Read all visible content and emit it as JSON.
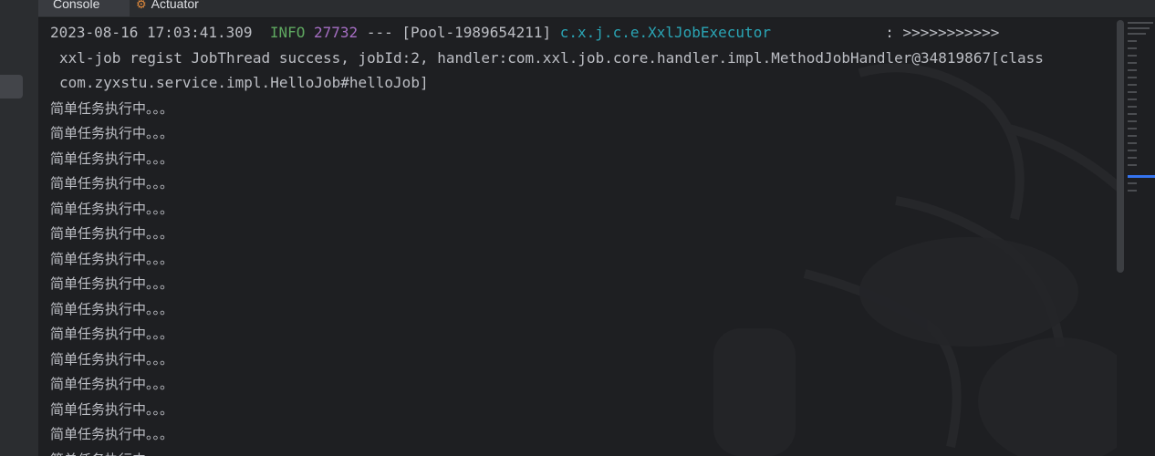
{
  "tabs": {
    "console_label": "Console",
    "actuator_label": "Actuator"
  },
  "log": {
    "header": {
      "timestamp": "2023-08-16 17:03:41.309",
      "level": "INFO",
      "pid": "27732",
      "separator": "---",
      "thread": "[Pool-1989654211]",
      "logger": "c.x.j.c.e.XxlJobExecutor",
      "arrow": ": >>>>>>>>>>>"
    },
    "continuation_1": "xxl-job regist JobThread success, jobId:2, handler:com.xxl.job.core.handler.impl.MethodJobHandler@34819867[class",
    "continuation_2": "com.zyxstu.service.impl.HelloJob#helloJob]",
    "task_lines": [
      "简单任务执行中。。。",
      "简单任务执行中。。。",
      "简单任务执行中。。。",
      "简单任务执行中。。。",
      "简单任务执行中。。。",
      "简单任务执行中。。。",
      "简单任务执行中。。。",
      "简单任务执行中。。。",
      "简单任务执行中。。。",
      "简单任务执行中。。。",
      "简单任务执行中。。。",
      "简单任务执行中。。。",
      "简单任务执行中。。。",
      "简单任务执行中。。。",
      "简单任务执行中"
    ]
  },
  "colors": {
    "background": "#1e1f22",
    "info_level": "#5fa860",
    "pid": "#a66ec4",
    "logger": "#2aa5b5",
    "text": "#bcbec4"
  },
  "icons": {
    "actuator": "actuator-icon"
  }
}
